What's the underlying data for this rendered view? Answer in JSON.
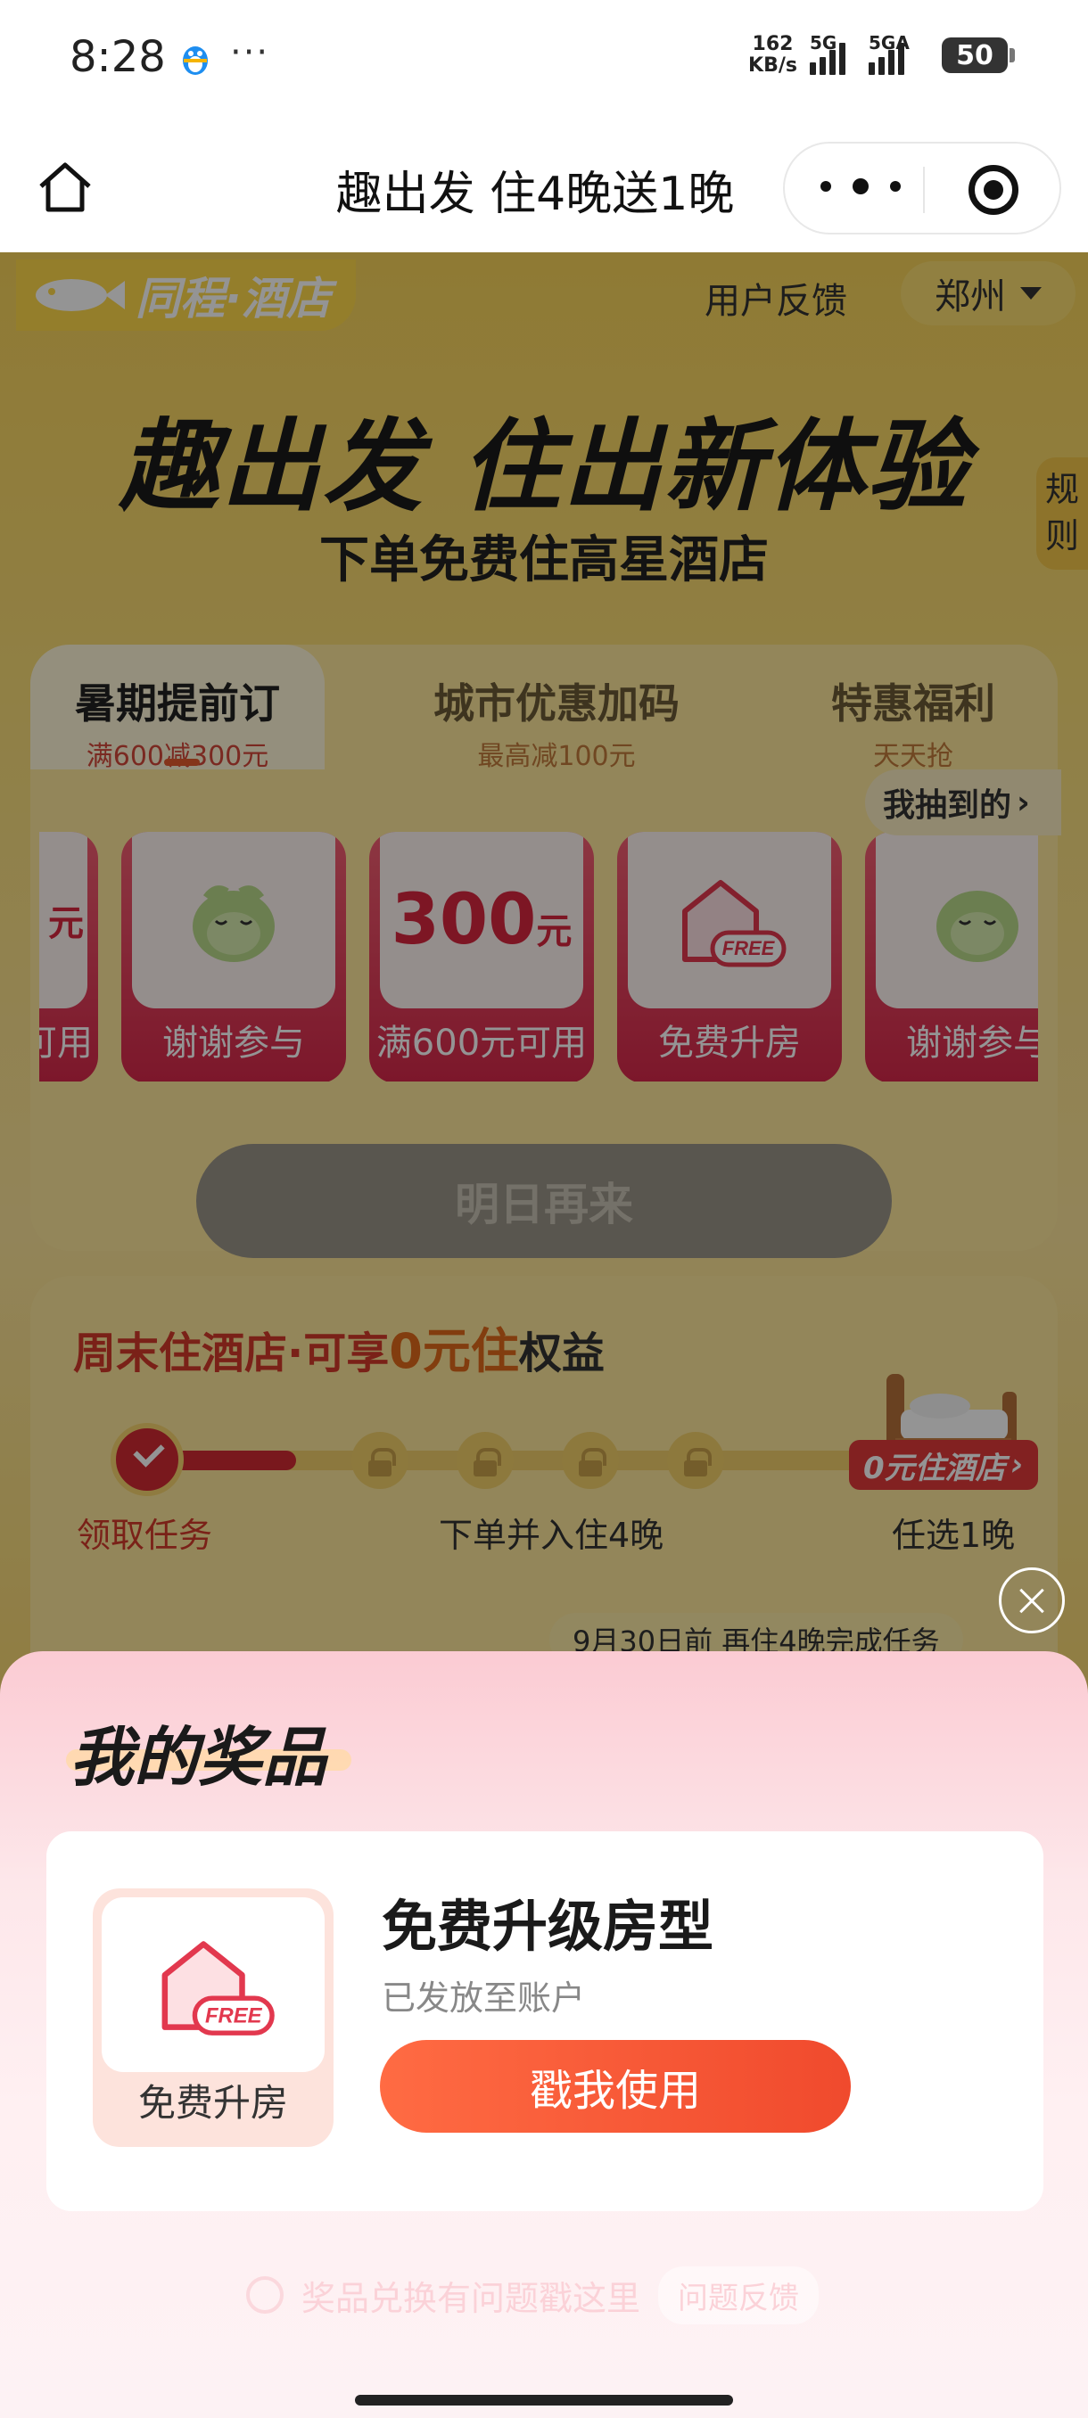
{
  "status_bar": {
    "time": "8:28",
    "speed": "162",
    "speed_unit": "KB/s",
    "net1": "5G",
    "net2": "5GA",
    "battery": "50"
  },
  "nav": {
    "title": "趣出发 住4晚送1晚"
  },
  "header": {
    "logo_text": "同程·酒店",
    "feedback": "用户反馈",
    "city": "郑州",
    "headline": "趣出发 住出新体验",
    "subhead": "下单免费住高星酒店",
    "rules": "规则"
  },
  "tabs": [
    {
      "title": "暑期提前订",
      "sub": "满600减300元"
    },
    {
      "title": "城市优惠加码",
      "sub": "最高减100元"
    },
    {
      "title": "特惠福利",
      "sub": "天天抢"
    }
  ],
  "prizes": [
    {
      "label": "可用",
      "amount": "元"
    },
    {
      "label": "谢谢参与"
    },
    {
      "label": "满600元可用",
      "amount": "300",
      "unit": "元"
    },
    {
      "label": "免费升房"
    },
    {
      "label": "谢谢参与"
    }
  ],
  "free_badge": "FREE",
  "draw": {
    "tomorrow": "明日再来",
    "mine": "我抽到的"
  },
  "task": {
    "title_prefix": "周末住酒店·可享",
    "title_highlight": "0元住",
    "title_suffix": "权益",
    "step1": "领取任务",
    "step2": "下单并入住4晚",
    "step3": "任选1晚",
    "zero_tag": "0元住酒店",
    "deadline": "9月30日前 再住4晚完成任务"
  },
  "sheet": {
    "title": "我的奖品",
    "prize_name": "免费升级房型",
    "prize_status": "已发放至账户",
    "thumb_label": "免费升房",
    "use_button": "戳我使用",
    "help_text": "奖品兑换有问题戳这里",
    "help_button": "问题反馈"
  },
  "colors": {
    "accent": "#f04a2d",
    "page_yellow": "#f7d35a",
    "prize_red": "#d6284a"
  }
}
